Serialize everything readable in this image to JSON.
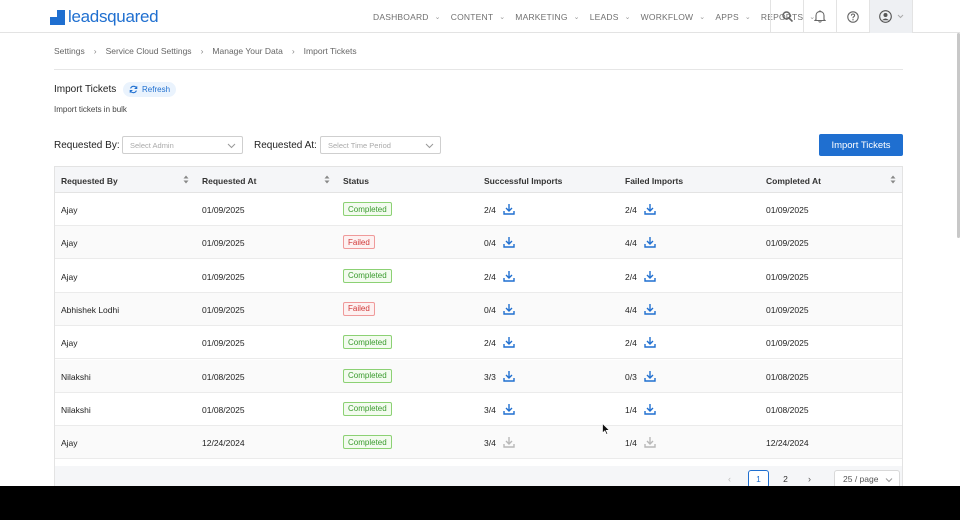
{
  "brand": {
    "logo_text": "leadsquared",
    "logo_color": "#1f6fd0"
  },
  "nav": {
    "items": [
      "DASHBOARD",
      "CONTENT",
      "MARKETING",
      "LEADS",
      "WORKFLOW",
      "APPS",
      "REPORTS"
    ],
    "icons": [
      "search-icon",
      "bell-icon",
      "help-icon",
      "user-icon"
    ]
  },
  "breadcrumb": [
    "Settings",
    "Service Cloud Settings",
    "Manage Your Data",
    "Import Tickets"
  ],
  "page": {
    "title": "Import Tickets",
    "refresh_label": "Refresh",
    "subtitle": "Import tickets in bulk"
  },
  "filters": {
    "requested_by_label": "Requested By:",
    "requested_by_placeholder": "Select Admin",
    "requested_at_label": "Requested At:",
    "requested_at_placeholder": "Select Time Period"
  },
  "import_button_label": "Import Tickets",
  "table": {
    "columns": [
      "Requested By",
      "Requested At",
      "Status",
      "Successful Imports",
      "Failed Imports",
      "Completed At"
    ],
    "rows": [
      {
        "requested_by": "Ajay",
        "requested_at": "01/09/2025",
        "status": "Completed",
        "successful": "2/4",
        "failed": "2/4",
        "completed_at": "01/09/2025"
      },
      {
        "requested_by": "Ajay",
        "requested_at": "01/09/2025",
        "status": "Failed",
        "successful": "0/4",
        "failed": "4/4",
        "completed_at": "01/09/2025"
      },
      {
        "requested_by": "Ajay",
        "requested_at": "01/09/2025",
        "status": "Completed",
        "successful": "2/4",
        "failed": "2/4",
        "completed_at": "01/09/2025"
      },
      {
        "requested_by": "Abhishek Lodhi",
        "requested_at": "01/09/2025",
        "status": "Failed",
        "successful": "0/4",
        "failed": "4/4",
        "completed_at": "01/09/2025"
      },
      {
        "requested_by": "Ajay",
        "requested_at": "01/09/2025",
        "status": "Completed",
        "successful": "2/4",
        "failed": "2/4",
        "completed_at": "01/09/2025"
      },
      {
        "requested_by": "Nilakshi",
        "requested_at": "01/08/2025",
        "status": "Completed",
        "successful": "3/3",
        "failed": "0/3",
        "completed_at": "01/08/2025"
      },
      {
        "requested_by": "Nilakshi",
        "requested_at": "01/08/2025",
        "status": "Completed",
        "successful": "3/4",
        "failed": "1/4",
        "completed_at": "01/08/2025"
      },
      {
        "requested_by": "Ajay",
        "requested_at": "12/24/2024",
        "status": "Completed",
        "successful": "3/4",
        "failed": "1/4",
        "completed_at": "12/24/2024"
      }
    ]
  },
  "pagination": {
    "pages": [
      "1",
      "2"
    ],
    "current": "1",
    "page_size": "25 / page"
  },
  "colors": {
    "primary": "#1f6fd0",
    "completed": "#3a9b2e",
    "failed": "#d03838"
  }
}
